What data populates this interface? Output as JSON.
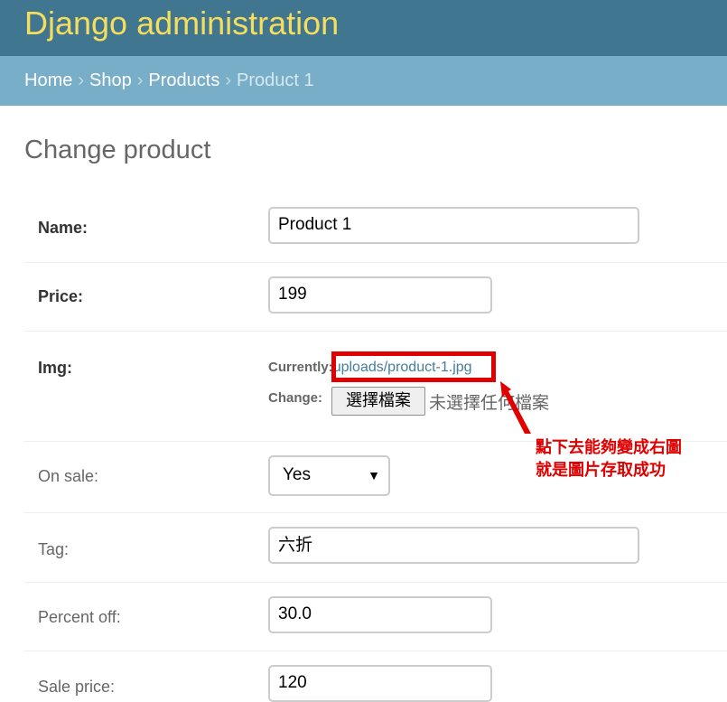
{
  "header": {
    "site_name": "Django administration"
  },
  "breadcrumbs": {
    "home": "Home",
    "app": "Shop",
    "model": "Products",
    "current": "Product 1",
    "separator": "›"
  },
  "page": {
    "title": "Change product"
  },
  "form": {
    "name": {
      "label": "Name:",
      "value": "Product 1"
    },
    "price": {
      "label": "Price:",
      "value": "199"
    },
    "img": {
      "label": "Img:",
      "currently_label": "Currently:",
      "current_file": "uploads/product-1.jpg",
      "change_label": "Change:",
      "choose_button": "選擇檔案",
      "no_file_text": "未選擇任何檔案"
    },
    "on_sale": {
      "label": "On sale:",
      "selected": "Yes"
    },
    "tag": {
      "label": "Tag:",
      "value": "六折"
    },
    "percent_off": {
      "label": "Percent off:",
      "value": "30.0"
    },
    "sale_price": {
      "label": "Sale price:",
      "value": "120"
    }
  },
  "annotation": {
    "line1": "點下去能夠變成右圖",
    "line2": "就是圖片存取成功",
    "color": "#e00000"
  },
  "colors": {
    "header_bg": "#417690",
    "site_name": "#f5dd5d",
    "breadcrumbs_bg": "#79aec8",
    "link": "#447e9b"
  }
}
